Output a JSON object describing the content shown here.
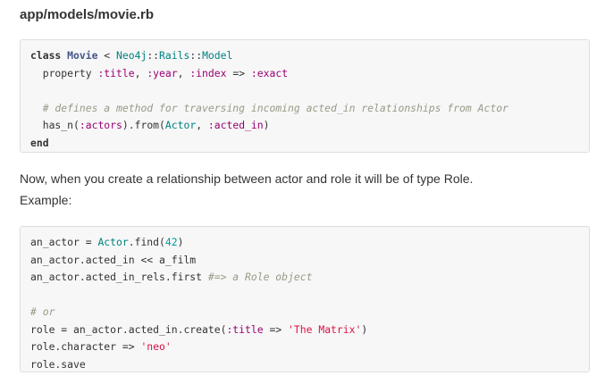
{
  "file_title": "app/models/movie.rb",
  "paragraph_1": "Now, when you create a relationship between actor and role it will be of type Role.",
  "paragraph_2": "Example:",
  "code_block_1": {
    "lines": [
      [
        {
          "t": "class",
          "c": "kw"
        },
        {
          "t": " "
        },
        {
          "t": "Movie",
          "c": "cls"
        },
        {
          "t": " < "
        },
        {
          "t": "Neo4j",
          "c": "const"
        },
        {
          "t": "::"
        },
        {
          "t": "Rails",
          "c": "const"
        },
        {
          "t": "::"
        },
        {
          "t": "Model",
          "c": "const"
        }
      ],
      [
        {
          "t": "  property "
        },
        {
          "t": ":title",
          "c": "sym"
        },
        {
          "t": ", "
        },
        {
          "t": ":year",
          "c": "sym"
        },
        {
          "t": ", "
        },
        {
          "t": ":index",
          "c": "sym"
        },
        {
          "t": " => "
        },
        {
          "t": ":exact",
          "c": "sym"
        }
      ],
      [],
      [
        {
          "t": "  "
        },
        {
          "t": "# defines a method for traversing incoming acted_in relationships from Actor",
          "c": "cmt"
        }
      ],
      [
        {
          "t": "  has_n("
        },
        {
          "t": ":actors",
          "c": "sym"
        },
        {
          "t": ").from("
        },
        {
          "t": "Actor",
          "c": "const"
        },
        {
          "t": ", "
        },
        {
          "t": ":acted_in",
          "c": "sym"
        },
        {
          "t": ")"
        }
      ],
      [
        {
          "t": "end",
          "c": "kw"
        }
      ]
    ]
  },
  "code_block_2": {
    "lines": [
      [
        {
          "t": "an_actor = "
        },
        {
          "t": "Actor",
          "c": "const"
        },
        {
          "t": ".find("
        },
        {
          "t": "42",
          "c": "num"
        },
        {
          "t": ")"
        }
      ],
      [
        {
          "t": "an_actor.acted_in << a_film"
        }
      ],
      [
        {
          "t": "an_actor.acted_in_rels.first "
        },
        {
          "t": "#=> a Role object",
          "c": "cmt"
        }
      ],
      [],
      [
        {
          "t": "# or",
          "c": "cmt"
        }
      ],
      [
        {
          "t": "role = an_actor.acted_in.create("
        },
        {
          "t": ":title",
          "c": "sym"
        },
        {
          "t": " => "
        },
        {
          "t": "'The Matrix'",
          "c": "str"
        },
        {
          "t": ")"
        }
      ],
      [
        {
          "t": "role.character => "
        },
        {
          "t": "'neo'",
          "c": "str"
        }
      ],
      [
        {
          "t": "role.save"
        }
      ]
    ]
  }
}
